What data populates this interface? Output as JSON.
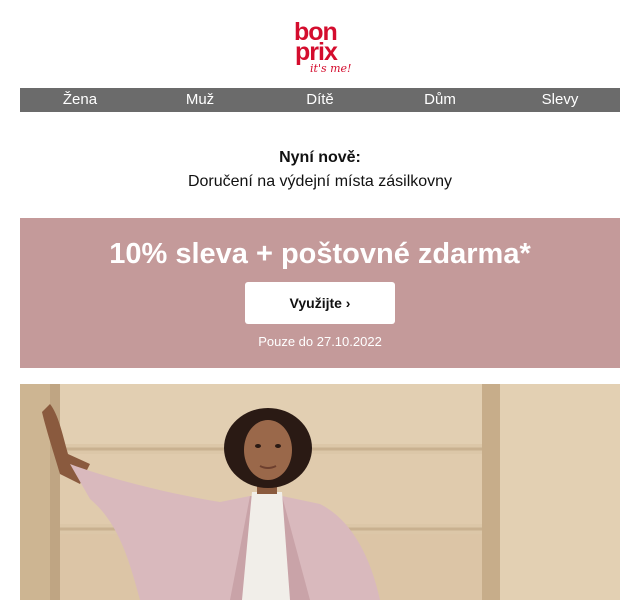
{
  "brand": {
    "logo_line1": "bon",
    "logo_line2": "prix",
    "logo_tagline": "it's me!",
    "color": "#d40d2e"
  },
  "nav": {
    "items": [
      "Žena",
      "Muž",
      "Dítě",
      "Dům",
      "Slevy"
    ],
    "background": "#6b6b6b"
  },
  "announcement": {
    "title": "Nyní nově:",
    "text": "Doručení na výdejní místa zásilkovny"
  },
  "promo": {
    "headline": "10% sleva + poštovné zdarma*",
    "button_label": "Využijte ›",
    "note": "Pouze do 27.10.2022",
    "background": "#c49a9a"
  },
  "hero": {
    "alt": "woman in pink teddy coat",
    "wall_color": "#dcc7a8",
    "coat_color": "#d9b9bd"
  }
}
